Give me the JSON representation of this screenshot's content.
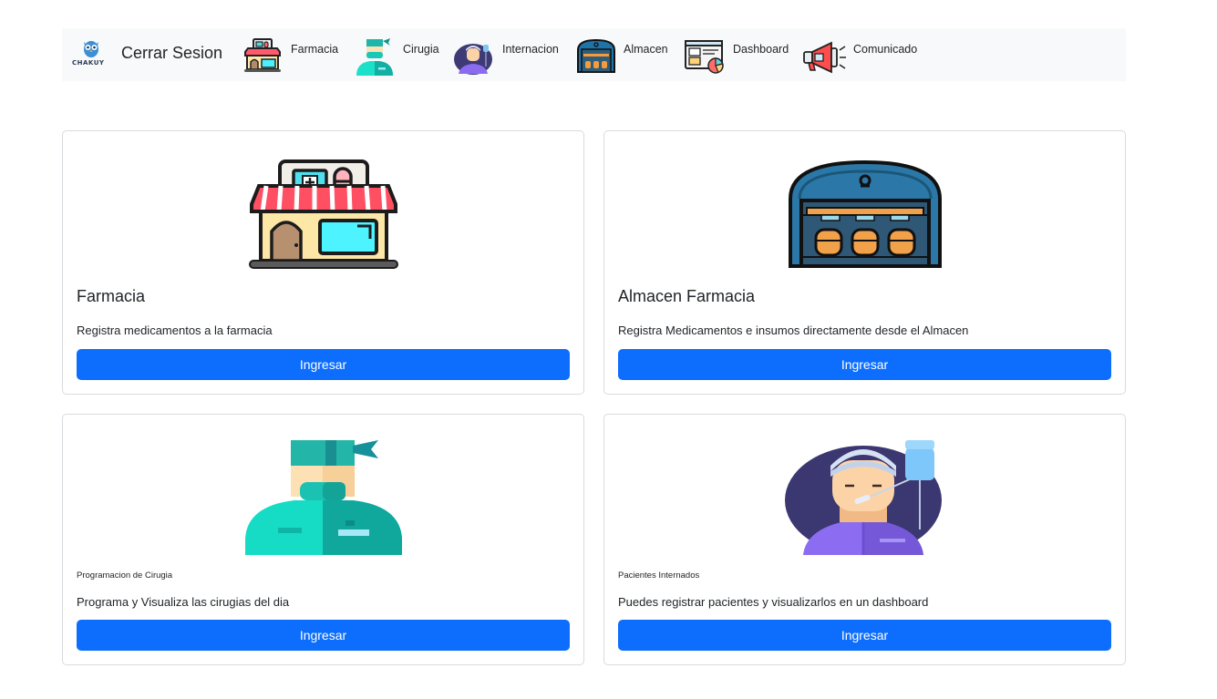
{
  "navbar": {
    "brand": "CHAKUY",
    "logout_label": "Cerrar Sesion",
    "items": [
      {
        "label": "Farmacia",
        "icon": "pharmacy-store-icon"
      },
      {
        "label": "Cirugia",
        "icon": "surgeon-icon"
      },
      {
        "label": "Internacion",
        "icon": "hospital-patient-icon"
      },
      {
        "label": "Almacen",
        "icon": "warehouse-icon"
      },
      {
        "label": "Dashboard",
        "icon": "dashboard-icon"
      },
      {
        "label": "Comunicado",
        "icon": "megaphone-icon"
      }
    ]
  },
  "cards": [
    {
      "title": "Farmacia",
      "text": "Registra medicamentos a la farmacia",
      "button": "Ingresar",
      "icon": "pharmacy-store-icon"
    },
    {
      "title": "Almacen Farmacia",
      "text": "Registra Medicamentos e insumos directamente desde el Almacen",
      "button": "Ingresar",
      "icon": "warehouse-icon"
    },
    {
      "title": "Programacion de Cirugia",
      "text": "Programa y Visualiza las cirugias del dia",
      "button": "Ingresar",
      "icon": "surgeon-icon"
    },
    {
      "title": "Pacientes Internados",
      "text": "Puedes registrar pacientes y visualizarlos en un dashboard",
      "button": "Ingresar",
      "icon": "hospital-patient-icon"
    }
  ],
  "colors": {
    "primary": "#0d6efd",
    "navbar_bg": "#f8f9fa",
    "border": "#d8dbdf"
  }
}
